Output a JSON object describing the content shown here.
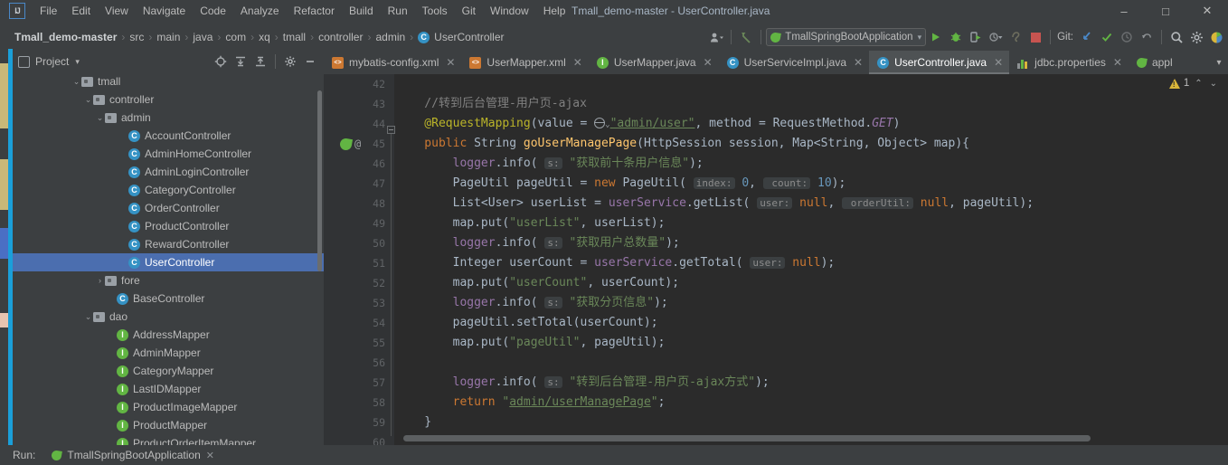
{
  "window": {
    "title": "Tmall_demo-master - UserController.java",
    "minimize": "–",
    "maximize": "□",
    "close": "✕"
  },
  "menubar": {
    "logo": "IJ",
    "items": [
      "File",
      "Edit",
      "View",
      "Navigate",
      "Code",
      "Analyze",
      "Refactor",
      "Build",
      "Run",
      "Tools",
      "Git",
      "Window",
      "Help"
    ]
  },
  "navbar": {
    "breadcrumbs": [
      {
        "label": "Tmall_demo-master",
        "icon": null
      },
      {
        "label": "src",
        "icon": null
      },
      {
        "label": "main",
        "icon": null
      },
      {
        "label": "java",
        "icon": null
      },
      {
        "label": "com",
        "icon": null
      },
      {
        "label": "xq",
        "icon": null
      },
      {
        "label": "tmall",
        "icon": null
      },
      {
        "label": "controller",
        "icon": null
      },
      {
        "label": "admin",
        "icon": null
      },
      {
        "label": "UserController",
        "icon": "class-badge"
      }
    ],
    "separator": "›",
    "run_config": "TmallSpringBootApplication",
    "run_config_caret": "▾",
    "git_label": "Git:",
    "icons": [
      "user-settings-icon",
      "back-arrow-icon",
      "run-icon",
      "debug-icon",
      "run-with-coverage-icon",
      "profile-icon",
      "attach-icon",
      "stop-icon",
      "git-update-icon",
      "git-commit-icon",
      "history-icon",
      "rollback-icon",
      "search-icon",
      "settings-icon",
      "browser-icon"
    ]
  },
  "project_panel": {
    "title": "Project",
    "caret": "▾",
    "actions": [
      "locate-icon",
      "expand-all-icon",
      "collapse-all-icon",
      "gear-icon",
      "hide-icon"
    ],
    "tree": [
      {
        "label": "tmall",
        "indent": 5,
        "arrow": "⌄",
        "icon": "folder",
        "selected": false
      },
      {
        "label": "controller",
        "indent": 6,
        "arrow": "⌄",
        "icon": "folder",
        "selected": false
      },
      {
        "label": "admin",
        "indent": 7,
        "arrow": "⌄",
        "icon": "folder",
        "selected": false
      },
      {
        "label": "AccountController",
        "indent": 9,
        "arrow": "",
        "icon": "class",
        "selected": false
      },
      {
        "label": "AdminHomeController",
        "indent": 9,
        "arrow": "",
        "icon": "class",
        "selected": false
      },
      {
        "label": "AdminLoginController",
        "indent": 9,
        "arrow": "",
        "icon": "class",
        "selected": false
      },
      {
        "label": "CategoryController",
        "indent": 9,
        "arrow": "",
        "icon": "class",
        "selected": false
      },
      {
        "label": "OrderController",
        "indent": 9,
        "arrow": "",
        "icon": "class",
        "selected": false
      },
      {
        "label": "ProductController",
        "indent": 9,
        "arrow": "",
        "icon": "class",
        "selected": false
      },
      {
        "label": "RewardController",
        "indent": 9,
        "arrow": "",
        "icon": "class",
        "selected": false
      },
      {
        "label": "UserController",
        "indent": 9,
        "arrow": "",
        "icon": "class",
        "selected": true
      },
      {
        "label": "fore",
        "indent": 7,
        "arrow": "›",
        "icon": "folder",
        "selected": false
      },
      {
        "label": "BaseController",
        "indent": 8,
        "arrow": "",
        "icon": "class",
        "selected": false
      },
      {
        "label": "dao",
        "indent": 6,
        "arrow": "⌄",
        "icon": "folder",
        "selected": false
      },
      {
        "label": "AddressMapper",
        "indent": 8,
        "arrow": "",
        "icon": "iface",
        "selected": false
      },
      {
        "label": "AdminMapper",
        "indent": 8,
        "arrow": "",
        "icon": "iface",
        "selected": false
      },
      {
        "label": "CategoryMapper",
        "indent": 8,
        "arrow": "",
        "icon": "iface",
        "selected": false
      },
      {
        "label": "LastIDMapper",
        "indent": 8,
        "arrow": "",
        "icon": "iface",
        "selected": false
      },
      {
        "label": "ProductImageMapper",
        "indent": 8,
        "arrow": "",
        "icon": "iface",
        "selected": false
      },
      {
        "label": "ProductMapper",
        "indent": 8,
        "arrow": "",
        "icon": "iface",
        "selected": false
      },
      {
        "label": "ProductOrderItemMapper",
        "indent": 8,
        "arrow": "",
        "icon": "iface",
        "selected": false
      }
    ]
  },
  "editor": {
    "tabs": [
      {
        "label": "mybatis-config.xml",
        "icon": "xml",
        "active": false,
        "close": "✕"
      },
      {
        "label": "UserMapper.xml",
        "icon": "xml",
        "active": false,
        "close": "✕"
      },
      {
        "label": "UserMapper.java",
        "icon": "iface",
        "active": false,
        "close": "✕"
      },
      {
        "label": "UserServiceImpl.java",
        "icon": "class",
        "active": false,
        "close": "✕"
      },
      {
        "label": "UserController.java",
        "icon": "class",
        "active": true,
        "close": "✕"
      },
      {
        "label": "jdbc.properties",
        "icon": "props",
        "active": false,
        "close": "✕"
      },
      {
        "label": "appl",
        "icon": "leaf",
        "active": false,
        "close": ""
      }
    ],
    "tab_overflow": "▾",
    "line_numbers": [
      "42",
      "43",
      "44",
      "45",
      "46",
      "47",
      "48",
      "49",
      "50",
      "51",
      "52",
      "53",
      "54",
      "55",
      "56",
      "57",
      "58",
      "59",
      "60"
    ],
    "gutter_icons_line": "45",
    "gutter_icon_names": [
      "spring-bean-icon",
      "annotation-icon"
    ],
    "inspection": {
      "warning_count": "1",
      "up_caret": "⌃",
      "down_caret": "⌄"
    },
    "code_lines": [
      {
        "n": "42",
        "text": ""
      },
      {
        "n": "43",
        "text": "    //转到后台管理-用户页-ajax"
      },
      {
        "n": "44",
        "text": "    @RequestMapping(value = \"admin/user\", method = RequestMethod.GET)"
      },
      {
        "n": "45",
        "text": "    public String goUserManagePage(HttpSession session, Map<String, Object> map){"
      },
      {
        "n": "46",
        "text": "        logger.info( s: \"获取前十条用户信息\");"
      },
      {
        "n": "47",
        "text": "        PageUtil pageUtil = new PageUtil( index: 0,  count: 10);"
      },
      {
        "n": "48",
        "text": "        List<User> userList = userService.getList( user: null,  orderUtil: null, pageUtil);"
      },
      {
        "n": "49",
        "text": "        map.put(\"userList\", userList);"
      },
      {
        "n": "50",
        "text": "        logger.info( s: \"获取用户总数量\");"
      },
      {
        "n": "51",
        "text": "        Integer userCount = userService.getTotal( user: null);"
      },
      {
        "n": "52",
        "text": "        map.put(\"userCount\", userCount);"
      },
      {
        "n": "53",
        "text": "        logger.info( s: \"获取分页信息\");"
      },
      {
        "n": "54",
        "text": "        pageUtil.setTotal(userCount);"
      },
      {
        "n": "55",
        "text": "        map.put(\"pageUtil\", pageUtil);"
      },
      {
        "n": "56",
        "text": ""
      },
      {
        "n": "57",
        "text": "        logger.info( s: \"转到后台管理-用户页-ajax方式\");"
      },
      {
        "n": "58",
        "text": "        return \"admin/userManagePage\";"
      },
      {
        "n": "59",
        "text": "    }"
      },
      {
        "n": "60",
        "text": ""
      }
    ]
  },
  "runbar": {
    "label": "Run:",
    "config": "TmallSpringBootApplication",
    "close": "✕"
  },
  "colors": {
    "accent_blue": "#4b6eaf",
    "class_badge": "#3592c4",
    "interface_badge": "#62b543",
    "editor_bg": "#2b2b2b",
    "panel_bg": "#3c3f41",
    "warning": "#d9b63a",
    "string": "#6a8759",
    "keyword": "#cc7832",
    "annotation": "#bbb529",
    "number": "#6897bb",
    "method": "#ffc66d"
  }
}
